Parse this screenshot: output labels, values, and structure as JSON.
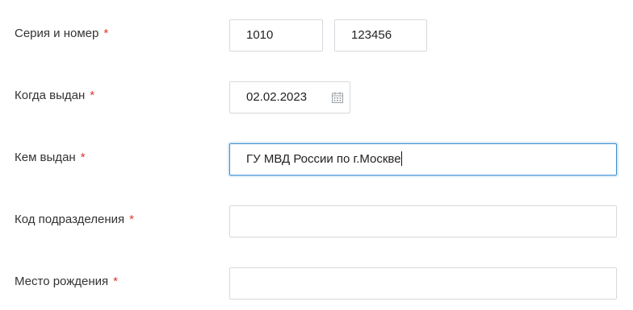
{
  "form": {
    "series_number": {
      "label": "Серия и номер",
      "required_mark": "*",
      "series_value": "1010",
      "number_value": "123456"
    },
    "issue_date": {
      "label": "Когда выдан",
      "required_mark": "*",
      "value": "02.02.2023",
      "icon": "calendar-icon"
    },
    "issued_by": {
      "label": "Кем выдан",
      "required_mark": "*",
      "value": "ГУ МВД России по г.Москве"
    },
    "department_code": {
      "label": "Код подразделения",
      "required_mark": "*",
      "value": ""
    },
    "birth_place": {
      "label": "Место рождения",
      "required_mark": "*",
      "value": ""
    }
  },
  "colors": {
    "label_text": "#333333",
    "required_mark": "#e0342d",
    "field_border": "#d6d9dd",
    "focus_border": "#3d8fd1"
  }
}
